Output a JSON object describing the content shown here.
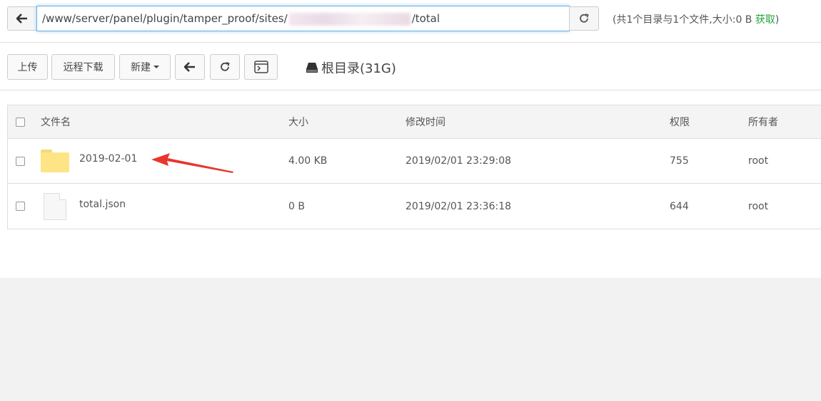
{
  "pathbar": {
    "path_prefix": "/www/server/panel/plugin/tamper_proof/sites/",
    "path_suffix": "/total",
    "dir_info": "(共1个目录与1个文件,大小:0 B ",
    "fetch_label": "获取",
    "dir_info_end": ")"
  },
  "toolbar": {
    "upload_label": "上传",
    "remote_download_label": "远程下载",
    "new_label": "新建",
    "root_dir_label": "根目录(31G)"
  },
  "table": {
    "headers": {
      "name": "文件名",
      "size": "大小",
      "mtime": "修改时间",
      "perm": "权限",
      "owner": "所有者"
    },
    "rows": [
      {
        "name": "2019-02-01",
        "size": "4.00 KB",
        "mtime": "2019/02/01 23:29:08",
        "perm": "755",
        "owner": "root",
        "type": "folder"
      },
      {
        "name": "total.json",
        "size": "0 B",
        "mtime": "2019/02/01 23:36:18",
        "perm": "644",
        "owner": "root",
        "type": "file"
      }
    ]
  },
  "colors": {
    "accent_green": "#20a53a",
    "annotation_red": "#e8362c",
    "folder_yellow": "#fde586"
  }
}
